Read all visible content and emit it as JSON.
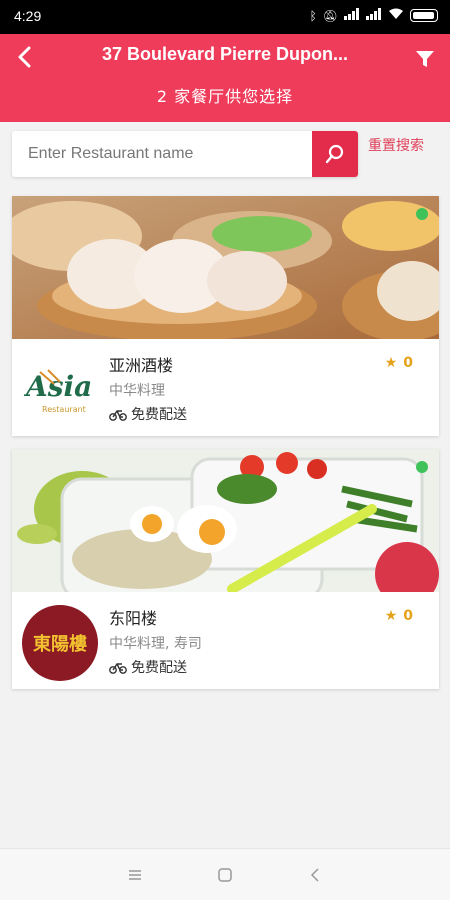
{
  "status_bar": {
    "time": "4:29"
  },
  "header": {
    "title": "37 Boulevard Pierre Dupon...",
    "subtitle": "2 家餐厅供您选择",
    "icons": {
      "back": "chevron-left-icon",
      "filter": "funnel-icon"
    }
  },
  "search": {
    "placeholder": "Enter Restaurant name",
    "value": "",
    "button_icon": "search-icon",
    "reset_label": "重置搜索"
  },
  "restaurants": [
    {
      "name": "亚洲酒楼",
      "cuisine": "中华料理",
      "delivery": "免费配送",
      "rating": "0",
      "open": true,
      "logo_text": "Asia",
      "logo_subtext": "Restaurant"
    },
    {
      "name": "东阳楼",
      "cuisine": "中华料理, 寿司",
      "delivery": "免费配送",
      "rating": "0",
      "open": true,
      "logo_text": "東陽樓"
    }
  ],
  "colors": {
    "brand": "#ef3c5a",
    "open": "#3fc25a",
    "star": "#e5a21b"
  }
}
